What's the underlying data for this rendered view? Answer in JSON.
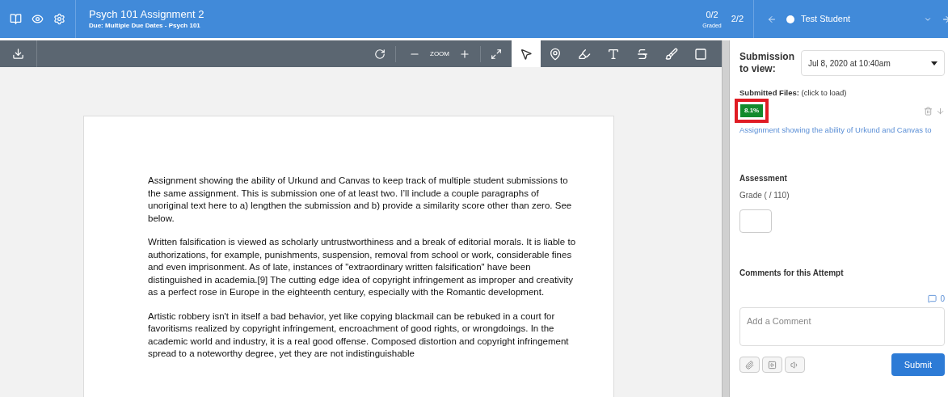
{
  "header": {
    "title": "Psych 101 Assignment 2",
    "subtitle": "Due: Multiple Due Dates - Psych 101",
    "graded_count": "0/2",
    "graded_label": "Graded",
    "position": "2/2",
    "student": "Test Student"
  },
  "toolbar": {
    "zoom_label": "ZOOM",
    "tools": [
      {
        "kind": "pointer",
        "selected": true
      },
      {
        "kind": "pin",
        "selected": false
      },
      {
        "kind": "highlight",
        "selected": false
      },
      {
        "kind": "text",
        "selected": false
      },
      {
        "kind": "strike",
        "selected": false
      },
      {
        "kind": "draw",
        "selected": false
      },
      {
        "kind": "area",
        "selected": false
      }
    ]
  },
  "document": {
    "paragraphs": [
      "Assignment showing the ability of Urkund and Canvas to keep track of multiple student submissions to the same assignment. This is submission one of at least two. I’ll include a couple paragraphs of unoriginal text here to a) lengthen the submission and b) provide a similarity score other than zero. See below.",
      "Written falsification is viewed as scholarly untrustworthiness and a break of editorial morals. It is liable to authorizations, for example, punishments, suspension, removal from school or work, considerable fines and even imprisonment. As of late, instances of \"extraordinary written falsification\" have been distinguished in academia.[9] The cutting edge idea of copyright infringement as improper and creativity as a perfect rose in Europe in the eighteenth century, especially with the Romantic development.",
      "Artistic robbery isn't in itself a bad behavior, yet like copying blackmail can be rebuked in a court for favoritisms realized by copyright infringement, encroachment of good rights, or wrongdoings. In the academic world and industry, it is a real good offense. Composed distortion and copyright infringement spread to a noteworthy degree, yet they are not indistinguishable"
    ]
  },
  "sidebar": {
    "submission_label": "Submission to view:",
    "submission_value": "Jul 8, 2020 at 10:40am",
    "files_label": "Submitted Files:",
    "files_hint": "(click to load)",
    "files": [
      {
        "score": "8.1%",
        "name": "Assignment showing the ability of Urkund and Canvas to"
      }
    ],
    "assessment_title": "Assessment",
    "grade_label": "Grade ( / 110)",
    "comments_title": "Comments for this Attempt",
    "comment_count": "0",
    "comment_placeholder": "Add a Comment",
    "submit": "Submit"
  }
}
